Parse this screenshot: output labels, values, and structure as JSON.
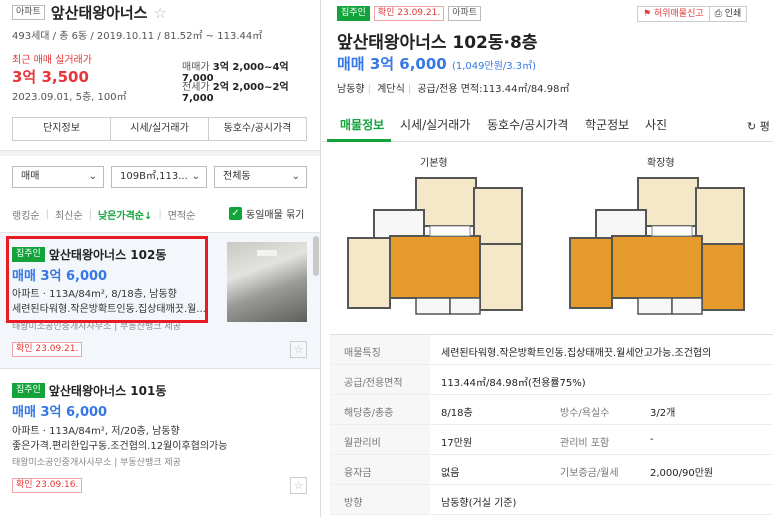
{
  "left": {
    "type_tag": "아파트",
    "complex_name": "앞산태왕아너스",
    "meta": "493세대 / 총 6동 / 2019.10.11 / 81.52㎡ ~ 113.44㎡",
    "recent_label": "최근 매매 실거래가",
    "recent_price": "3억 3,500",
    "recent_date": "2023.09.01, 5층, 100㎡",
    "sale_label": "매매가",
    "sale_range": "3억 2,000~4억 7,000",
    "jeonse_label": "전세가",
    "jeonse_range": "2억 2,000~2억 7,000",
    "tabs": [
      "단지정보",
      "시세/실거래가",
      "동호수/공시가격"
    ],
    "filters": [
      "매매",
      "109B㎡,113...",
      "전체동"
    ],
    "sort": [
      "랭킹순",
      "최신순",
      "낮은가격순↓",
      "면적순"
    ],
    "same_listing": "동일매물 묶기",
    "listings": [
      {
        "tag": "집주인",
        "name": "앞산태왕아너스 102동",
        "price": "매매 3억 6,000",
        "info1": "아파트 · 113A/84m², 8/18층, 남동향",
        "info2": "세련된타워형.작은방확트인동.집상태깨끗.월...",
        "agent": "태왕미소공인중개사사무소 | 부동산뱅크 제공",
        "confirm": "확인 23.09.21."
      },
      {
        "tag": "집주인",
        "name": "앞산태왕아너스 101동",
        "price": "매매 3억 6,000",
        "info1": "아파트 · 113A/84m², 저/20층, 남동향",
        "info2": "좋은가격.편리한입구동.조건협의.12월이후협의가능",
        "agent": "태왕미소공인중개사사무소 | 부동산뱅크 제공",
        "confirm": "확인 23.09.16."
      }
    ]
  },
  "right": {
    "tag": "집주인",
    "confirm": "확인 23.09.21.",
    "type_tag": "아파트",
    "report_btn": "허위매물신고",
    "print_btn": "인쇄",
    "title": "앞산태왕아너스 102동·8층",
    "price": "매매 3억 6,000",
    "price_sub": "(1,049만원/3.3㎡)",
    "meta": [
      "남동향",
      "계단식",
      "공급/전용 면적:113.44㎡/84.98㎡"
    ],
    "tabs": [
      "매물정보",
      "시세/실거래가",
      "동호수/공시가격",
      "학군정보",
      "사진"
    ],
    "refresh": "평",
    "plan_basic": "기본형",
    "plan_ext": "확장형",
    "table": [
      {
        "k": "매물특징",
        "v": "세련된타워형.작은방확트인동.집상태깨끗.월세안고가능.조건협의"
      },
      {
        "k": "공급/전용면적",
        "v": "113.44㎡/84.98㎡(전용률75%)"
      },
      {
        "k": "해당층/총층",
        "v": "8/18층",
        "k2": "방수/욕실수",
        "v2": "3/2개"
      },
      {
        "k": "월관리비",
        "v": "17만원",
        "k2": "관리비 포함",
        "v2": "-"
      },
      {
        "k": "융자금",
        "v": "없음",
        "k2": "기보증금/월세",
        "v2": "2,000/90만원"
      },
      {
        "k": "방향",
        "v": "남동향(거실 기준)"
      }
    ]
  }
}
